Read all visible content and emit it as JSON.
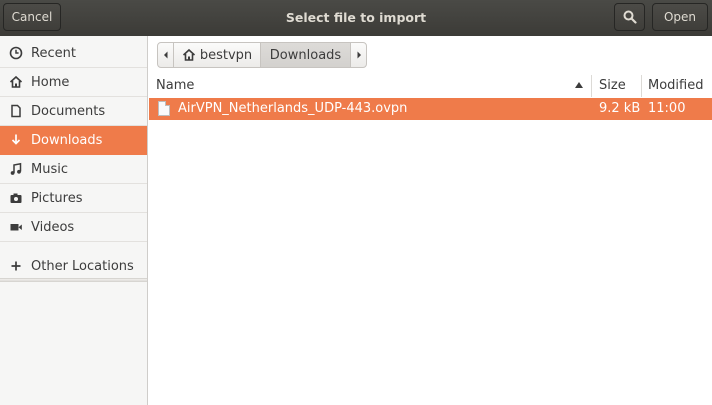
{
  "window": {
    "title": "Select file to import",
    "cancel_label": "Cancel",
    "open_label": "Open",
    "search_icon": "search-icon"
  },
  "sidebar": {
    "items": [
      {
        "label": "Recent",
        "icon": "clock-icon"
      },
      {
        "label": "Home",
        "icon": "home-icon"
      },
      {
        "label": "Documents",
        "icon": "document-icon"
      },
      {
        "label": "Downloads",
        "icon": "download-icon",
        "active": true
      },
      {
        "label": "Music",
        "icon": "music-note-icon"
      },
      {
        "label": "Pictures",
        "icon": "camera-icon"
      },
      {
        "label": "Videos",
        "icon": "video-icon"
      }
    ],
    "other": {
      "label": "Other Locations",
      "icon": "plus-icon"
    }
  },
  "pathbar": {
    "home_label": "bestvpn",
    "current_label": "Downloads"
  },
  "columns": {
    "name": "Name",
    "size": "Size",
    "modified": "Modified"
  },
  "files": [
    {
      "name": "AirVPN_Netherlands_UDP-443.ovpn",
      "size": "9.2 kB",
      "modified": "11:00",
      "selected": true
    }
  ],
  "colors": {
    "accent": "#ef7b4a",
    "titlebar": "#3c3b37"
  }
}
